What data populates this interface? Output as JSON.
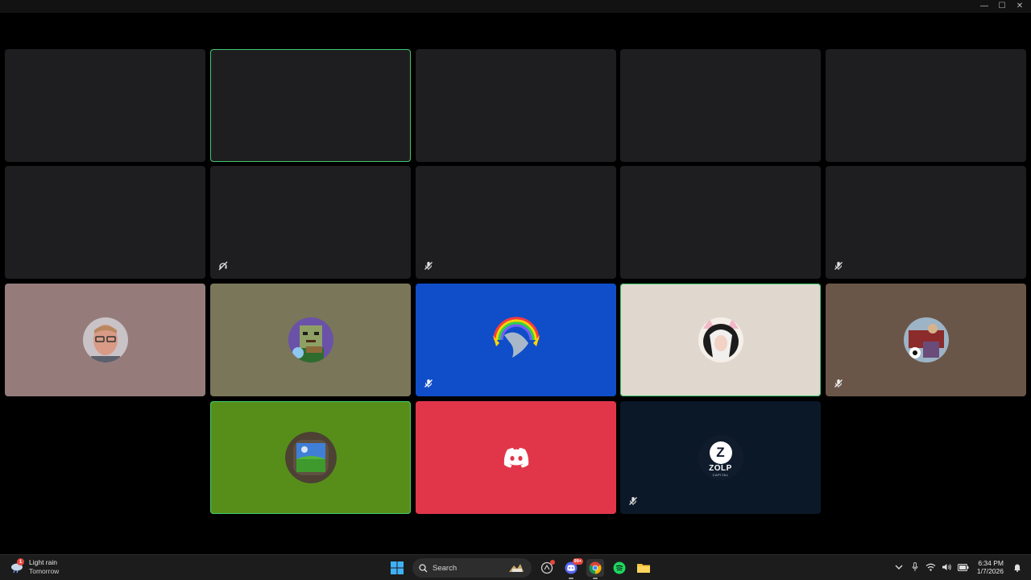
{
  "window": {
    "minimize_glyph": "—",
    "maximize_glyph": "☐",
    "close_glyph": "✕"
  },
  "tiles": [
    {
      "id": "participant-tile-1",
      "bg": "#1e1e20",
      "speaking": false,
      "muted": null,
      "avatar": null
    },
    {
      "id": "participant-tile-2",
      "bg": "#1e1e20",
      "speaking": true,
      "muted": null,
      "avatar": null
    },
    {
      "id": "participant-tile-3",
      "bg": "#1e1e20",
      "speaking": false,
      "muted": null,
      "avatar": null
    },
    {
      "id": "participant-tile-4",
      "bg": "#1e1e20",
      "speaking": false,
      "muted": null,
      "avatar": null
    },
    {
      "id": "participant-tile-5",
      "bg": "#1e1e20",
      "speaking": false,
      "muted": null,
      "avatar": null
    },
    {
      "id": "participant-tile-6",
      "bg": "#1e1e20",
      "speaking": false,
      "muted": null,
      "avatar": null
    },
    {
      "id": "participant-tile-7",
      "bg": "#1e1e20",
      "speaking": false,
      "muted": "deafened",
      "avatar": null
    },
    {
      "id": "participant-tile-8",
      "bg": "#1e1e20",
      "speaking": false,
      "muted": "mic-off",
      "avatar": null
    },
    {
      "id": "participant-tile-9",
      "bg": "#1e1e20",
      "speaking": false,
      "muted": null,
      "avatar": null
    },
    {
      "id": "participant-tile-10",
      "bg": "#1e1e20",
      "speaking": false,
      "muted": "mic-off",
      "avatar": null
    },
    {
      "id": "participant-tile-11",
      "bg": "#957c7b",
      "speaking": false,
      "muted": null,
      "avatar": "photo-face"
    },
    {
      "id": "participant-tile-12",
      "bg": "#7a7659",
      "speaking": false,
      "muted": null,
      "avatar": "pixel-character"
    },
    {
      "id": "participant-tile-13",
      "bg": "#0f4ec8",
      "speaking": false,
      "muted": "mic-off",
      "avatar": "dolphin-rainbow"
    },
    {
      "id": "participant-tile-14",
      "bg": "#e0d7cf",
      "speaking": true,
      "muted": null,
      "avatar": "anime-cat-ears"
    },
    {
      "id": "participant-tile-15",
      "bg": "#6a5648",
      "speaking": false,
      "muted": "mic-off",
      "avatar": "cartoon-group"
    },
    {
      "id": "participant-tile-16",
      "bg": "#578e1a",
      "speaking": true,
      "muted": null,
      "avatar": "landscape-frame"
    },
    {
      "id": "participant-tile-17",
      "bg": "#e1364a",
      "speaking": false,
      "muted": null,
      "avatar": "discord-logo"
    },
    {
      "id": "participant-tile-18",
      "bg": "#0b1828",
      "speaking": false,
      "muted": "mic-off",
      "avatar": "zolp-logo"
    }
  ],
  "zolp_logo": {
    "letter": "Z",
    "name": "ZOLP",
    "sub": "CAPITAL"
  },
  "taskbar": {
    "weather": {
      "line1": "Light rain",
      "line2": "Tomorrow",
      "badge": "1"
    },
    "search": {
      "label": "Search"
    },
    "apps": [
      "start-icon",
      "search-box",
      "copilot-icon",
      "discord-icon",
      "chrome-icon",
      "spotify-icon",
      "file-explorer-icon"
    ],
    "discord_badge": "99+",
    "clock": {
      "time": "6:34 PM",
      "date": "1/7/2026"
    }
  }
}
